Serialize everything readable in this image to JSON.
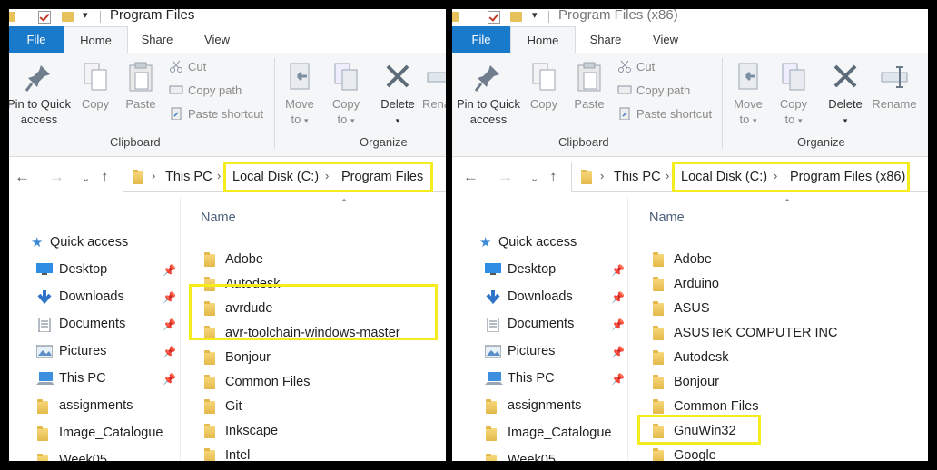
{
  "left": {
    "title": "Program Files",
    "tabs": {
      "file": "File",
      "home": "Home",
      "share": "Share",
      "view": "View"
    },
    "ribbon": {
      "pin": [
        "Pin to Quick",
        "access"
      ],
      "copy": "Copy",
      "paste": "Paste",
      "cut": "Cut",
      "copy_path": "Copy path",
      "paste_shortcut": "Paste shortcut",
      "clipboard": "Clipboard",
      "move_to": [
        "Move",
        "to"
      ],
      "copy_to": [
        "Copy",
        "to"
      ],
      "delete": "Delete",
      "rename": "Rena",
      "organize": "Organize"
    },
    "breadcrumb": [
      "This PC",
      "Local Disk (C:)",
      "Program Files"
    ],
    "nav": {
      "quick_access": "Quick access",
      "items": [
        "Desktop",
        "Downloads",
        "Documents",
        "Pictures",
        "This PC",
        "assignments",
        "Image_Catalogue",
        "Week05"
      ]
    },
    "list": {
      "header": "Name",
      "items": [
        "Adobe",
        "Autodesk",
        "avrdude",
        "avr-toolchain-windows-master",
        "Bonjour",
        "Common Files",
        "Git",
        "Inkscape",
        "Intel"
      ]
    }
  },
  "right": {
    "title": "Program Files (x86)",
    "tabs": {
      "file": "File",
      "home": "Home",
      "share": "Share",
      "view": "View"
    },
    "ribbon": {
      "pin": [
        "Pin to Quick",
        "access"
      ],
      "copy": "Copy",
      "paste": "Paste",
      "cut": "Cut",
      "copy_path": "Copy path",
      "paste_shortcut": "Paste shortcut",
      "clipboard": "Clipboard",
      "move_to": [
        "Move",
        "to"
      ],
      "copy_to": [
        "Copy",
        "to"
      ],
      "delete": "Delete",
      "rename": "Rename",
      "organize": "Organize"
    },
    "breadcrumb": [
      "This PC",
      "Local Disk (C:)",
      "Program Files (x86)"
    ],
    "nav": {
      "quick_access": "Quick access",
      "items": [
        "Desktop",
        "Downloads",
        "Documents",
        "Pictures",
        "This PC",
        "assignments",
        "Image_Catalogue",
        "Week05"
      ]
    },
    "list": {
      "header": "Name",
      "items": [
        "Adobe",
        "Arduino",
        "ASUS",
        "ASUSTeK COMPUTER INC",
        "Autodesk",
        "Bonjour",
        "Common Files",
        "GnuWin32",
        "Google"
      ]
    }
  },
  "colors": {
    "accent": "#1979ca",
    "highlight": "#f4ec1d",
    "folder": "#e4b849"
  }
}
